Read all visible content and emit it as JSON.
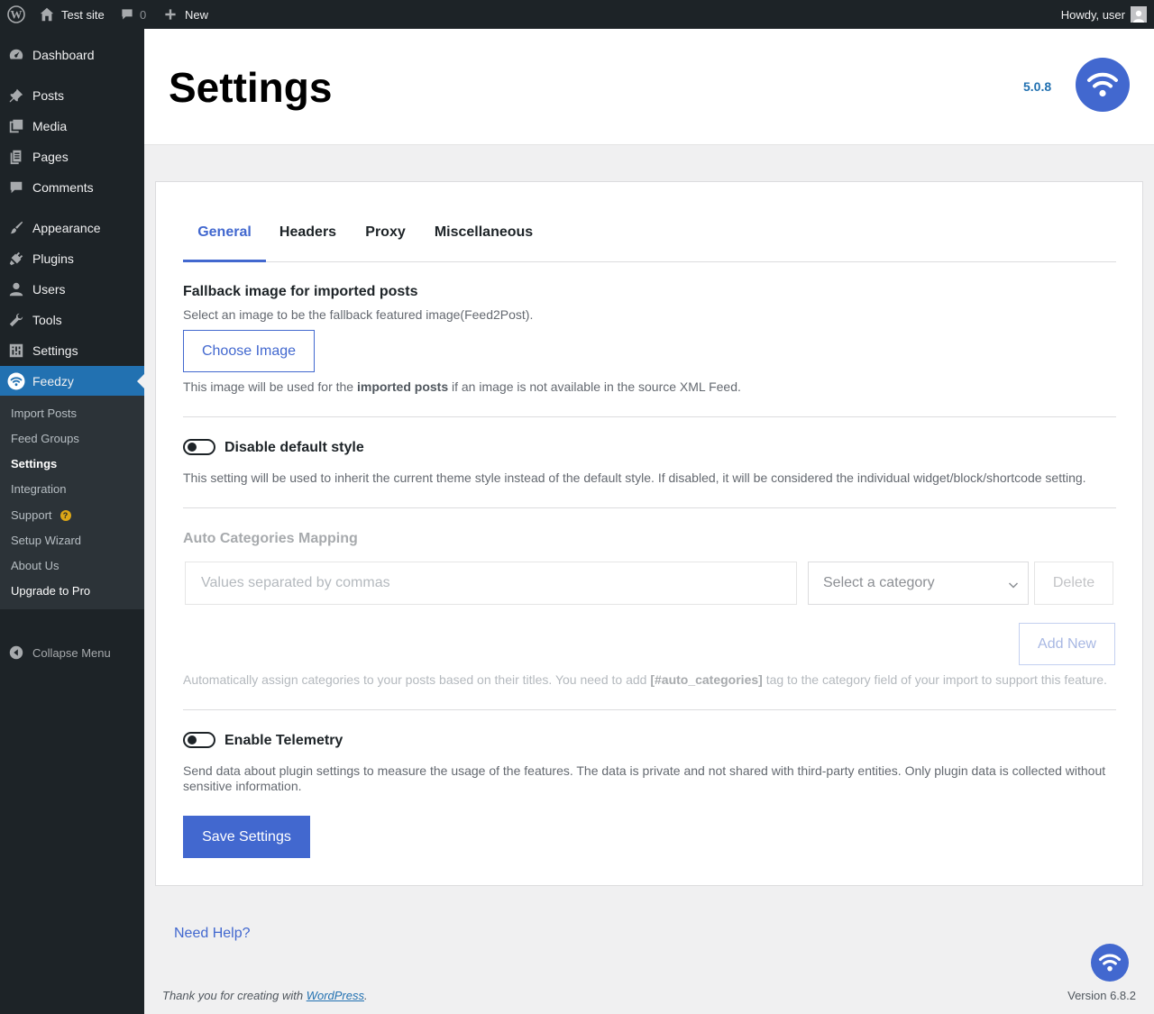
{
  "admin_bar": {
    "site_name": "Test site",
    "comments_count": "0",
    "new_label": "New",
    "howdy": "Howdy, user"
  },
  "sidebar": {
    "items": [
      {
        "label": "Dashboard",
        "icon": "dashboard-icon"
      },
      {
        "label": "Posts",
        "icon": "pin-icon"
      },
      {
        "label": "Media",
        "icon": "media-icon"
      },
      {
        "label": "Pages",
        "icon": "pages-icon"
      },
      {
        "label": "Comments",
        "icon": "comment-icon"
      },
      {
        "label": "Appearance",
        "icon": "brush-icon"
      },
      {
        "label": "Plugins",
        "icon": "plugin-icon"
      },
      {
        "label": "Users",
        "icon": "user-icon"
      },
      {
        "label": "Tools",
        "icon": "wrench-icon"
      },
      {
        "label": "Settings",
        "icon": "settings-icon"
      },
      {
        "label": "Feedzy",
        "icon": "feedzy-icon"
      }
    ],
    "submenu": [
      {
        "label": "Import Posts"
      },
      {
        "label": "Feed Groups"
      },
      {
        "label": "Settings"
      },
      {
        "label": "Integration"
      },
      {
        "label": "Support",
        "badge": "?"
      },
      {
        "label": "Setup Wizard"
      },
      {
        "label": "About Us"
      },
      {
        "label": "Upgrade to Pro"
      }
    ],
    "collapse_label": "Collapse Menu"
  },
  "header": {
    "title": "Settings",
    "version": "5.0.8"
  },
  "tabs": [
    {
      "label": "General",
      "active": true
    },
    {
      "label": "Headers",
      "active": false
    },
    {
      "label": "Proxy",
      "active": false
    },
    {
      "label": "Miscellaneous",
      "active": false
    }
  ],
  "fallback": {
    "title": "Fallback image for imported posts",
    "description": "Select an image to be the fallback featured image(Feed2Post).",
    "button_label": "Choose Image",
    "note_before": "This image will be used for the ",
    "note_bold": "imported posts",
    "note_after": " if an image is not available in the source XML Feed."
  },
  "default_style": {
    "label": "Disable default style",
    "enabled": false,
    "description": "This setting will be used to inherit the current theme style instead of the default style. If disabled, it will be considered the individual widget/block/shortcode setting."
  },
  "auto_categories": {
    "title": "Auto Categories Mapping",
    "input_placeholder": "Values separated by commas",
    "select_value": "Select a category",
    "delete_label": "Delete",
    "add_label": "Add New",
    "help_before": "Automatically assign categories to your posts based on their titles. You need to add ",
    "help_bold": "[#auto_categories]",
    "help_after": " tag to the category field of your import to support this feature."
  },
  "telemetry": {
    "label": "Enable Telemetry",
    "enabled": false,
    "description": "Send data about plugin settings to measure the usage of the features. The data is private and not shared with third-party entities. Only plugin data is collected without sensitive information."
  },
  "save_label": "Save Settings",
  "need_help": "Need Help?",
  "footer": {
    "thanks_before": "Thank you for creating with ",
    "thanks_link": "WordPress",
    "thanks_after": ".",
    "version": "Version 6.8.2"
  },
  "colors": {
    "accent": "#4268cf",
    "admin_dark": "#1d2327",
    "wp_blue": "#2271b1"
  }
}
